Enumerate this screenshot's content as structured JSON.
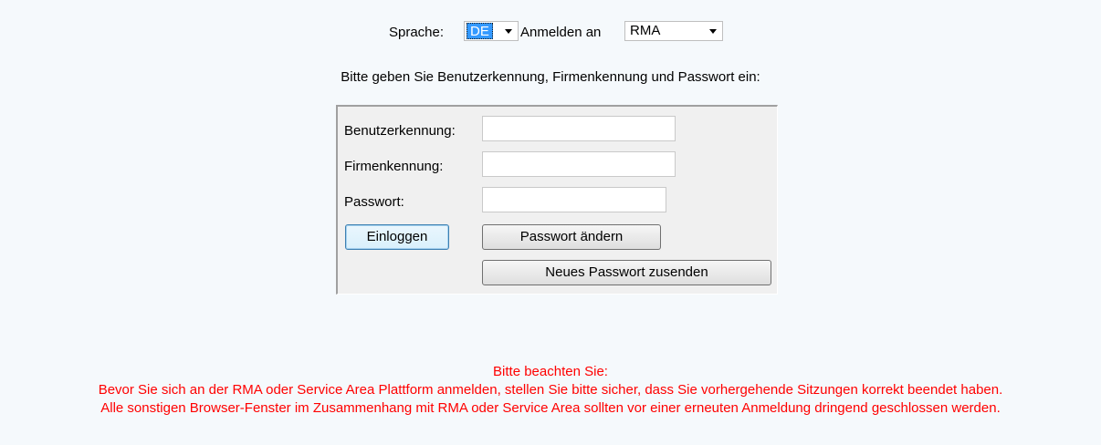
{
  "header": {
    "language_label": "Sprache:",
    "language_value": "DE",
    "login_to_label": "Anmelden an",
    "login_to_value": "RMA"
  },
  "instruction": "Bitte geben Sie Benutzerkennung, Firmenkennung und Passwort ein:",
  "form": {
    "user_id_label": "Benutzerkennung:",
    "user_id_value": "",
    "company_id_label": "Firmenkennung:",
    "company_id_value": "",
    "password_label": "Passwort:",
    "password_value": "",
    "login_button": "Einloggen",
    "change_password_button": "Passwort ändern",
    "send_new_password_button": "Neues Passwort zusenden"
  },
  "notice": {
    "title": "Bitte beachten Sie:",
    "line1": "Bevor Sie sich an der RMA oder Service Area Plattform anmelden, stellen Sie bitte sicher, dass Sie vorhergehende Sitzungen korrekt beendet haben.",
    "line2": "Alle sonstigen Browser-Fenster im Zusammenhang mit RMA oder Service Area sollten vor einer erneuten Anmeldung dringend geschlossen werden."
  },
  "colors": {
    "background": "#f5f9fc",
    "notice_text": "#ff0000",
    "selection_highlight": "#3399ff"
  }
}
